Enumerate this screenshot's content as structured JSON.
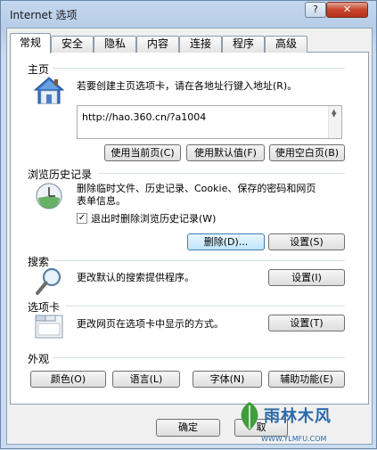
{
  "window": {
    "title": "Internet 选项",
    "help_label": "?",
    "close_label": "✕"
  },
  "tabs": [
    "常规",
    "安全",
    "隐私",
    "内容",
    "连接",
    "程序",
    "高级"
  ],
  "home": {
    "label": "主页",
    "description": "若要创建主页选项卡，请在各地址行键入地址(R)。",
    "url": "http://hao.360.cn/?a1004",
    "buttons": {
      "current": "使用当前页(C)",
      "default": "使用默认值(F)",
      "blank": "使用空白页(B)"
    }
  },
  "history": {
    "label": "浏览历史记录",
    "description_line1": "删除临时文件、历史记录、Cookie、保存的密码和网页",
    "description_line2": "表单信息。",
    "checkbox_label": "退出时删除浏览历史记录(W)",
    "checkbox_checked": true,
    "delete_button": "删除(D)...",
    "settings_button": "设置(S)"
  },
  "search": {
    "label": "搜索",
    "description": "更改默认的搜索提供程序。",
    "settings_button": "设置(I)"
  },
  "tabs_section": {
    "label": "选项卡",
    "description": "更改网页在选项卡中显示的方式。",
    "settings_button": "设置(T)"
  },
  "appearance": {
    "label": "外观",
    "buttons": {
      "colors": "颜色(O)",
      "languages": "语言(L)",
      "fonts": "字体(N)",
      "accessibility": "辅助功能(E)"
    }
  },
  "footer": {
    "ok": "确定",
    "cancel": "取"
  },
  "watermark": {
    "text": "雨林木风",
    "url": "WWW.YLMFU.COM"
  },
  "icons": {
    "home": "house-icon",
    "history": "history-icon",
    "search": "magnifier-icon",
    "tabs": "tabs-icon"
  }
}
